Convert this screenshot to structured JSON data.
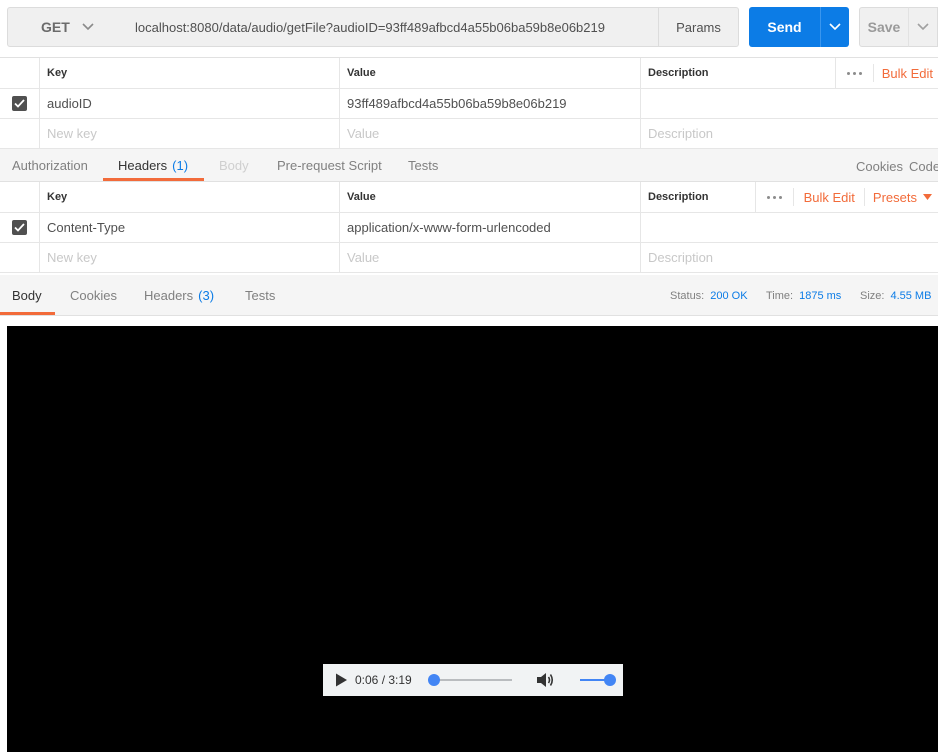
{
  "request": {
    "method": "GET",
    "url": "localhost:8080/data/audio/getFile?audioID=93ff489afbcd4a55b06ba59b8e06b219",
    "params_label": "Params",
    "send_label": "Send",
    "save_label": "Save"
  },
  "params_table": {
    "columns": [
      "Key",
      "Value",
      "Description"
    ],
    "bulk_edit": "Bulk Edit",
    "rows": [
      {
        "checked": true,
        "key": "audioID",
        "value": "93ff489afbcd4a55b06ba59b8e06b219",
        "description": ""
      }
    ],
    "placeholder": {
      "key": "New key",
      "value": "Value",
      "description": "Description"
    }
  },
  "request_tabs": {
    "items": [
      {
        "label": "Authorization"
      },
      {
        "label": "Headers",
        "count": "(1)"
      },
      {
        "label": "Body"
      },
      {
        "label": "Pre-request Script"
      },
      {
        "label": "Tests"
      }
    ],
    "active": "Headers",
    "cookies": "Cookies",
    "code": "Code"
  },
  "headers_table": {
    "columns": [
      "Key",
      "Value",
      "Description"
    ],
    "bulk_edit": "Bulk Edit",
    "presets": "Presets",
    "rows": [
      {
        "checked": true,
        "key": "Content-Type",
        "value": "application/x-www-form-urlencoded",
        "description": ""
      }
    ],
    "placeholder": {
      "key": "New key",
      "value": "Value",
      "description": "Description"
    }
  },
  "response": {
    "tabs": [
      {
        "label": "Body"
      },
      {
        "label": "Cookies"
      },
      {
        "label": "Headers",
        "count": "(3)"
      },
      {
        "label": "Tests"
      }
    ],
    "active": "Body",
    "status_label": "Status:",
    "status_value": "200 OK",
    "time_label": "Time:",
    "time_value": "1875 ms",
    "size_label": "Size:",
    "size_value": "4.55 MB"
  },
  "audio_player": {
    "time_display": "0:06 / 3:19",
    "progress_fraction": 0.0,
    "volume_fraction": 1.0
  },
  "colors": {
    "accent_orange": "#f26b3a",
    "send_blue": "#0c7ce6",
    "media_background": "#000000",
    "player_accent": "#4285f4"
  }
}
